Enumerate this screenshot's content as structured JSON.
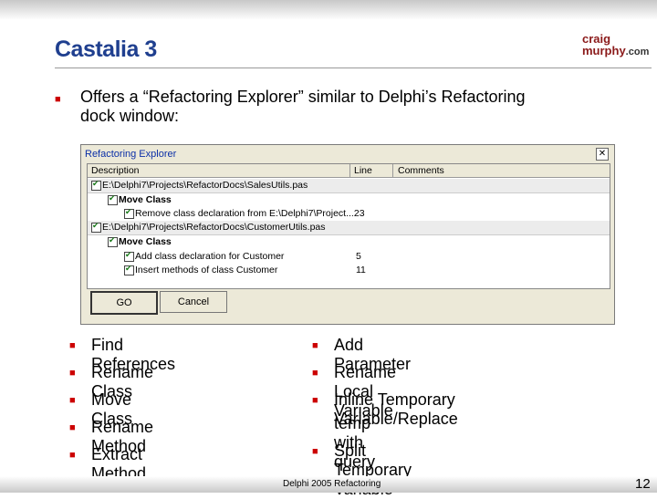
{
  "slide": {
    "title": "Castalia 3",
    "logo_line1": "craig",
    "logo_line2": "murphy",
    "logo_line2_suffix": ".com",
    "intro_line1": "Offers a “Refactoring Explorer” similar to Delphi’s Refactoring",
    "intro_line2": "dock window:",
    "footer": "Delphi 2005 Refactoring",
    "page_number": "12"
  },
  "window": {
    "title": "Refactoring Explorer",
    "close_glyph": "✕",
    "columns": [
      "Description",
      "Line",
      "Comments"
    ],
    "rows": [
      {
        "text": "E:\\Delphi7\\Projects\\RefactorDocs\\SalesUtils.pas",
        "line": ""
      },
      {
        "text": "Move Class",
        "line": ""
      },
      {
        "text": "Remove class declaration from E:\\Delphi7\\Project...23",
        "line": ""
      },
      {
        "text": "E:\\Delphi7\\Projects\\RefactorDocs\\CustomerUtils.pas",
        "line": ""
      },
      {
        "text": "Move Class",
        "line": ""
      },
      {
        "text": "Add class declaration for Customer",
        "line": "5"
      },
      {
        "text": "Insert methods of class Customer",
        "line": "11"
      }
    ],
    "go_label": "GO",
    "cancel_label": "Cancel"
  },
  "left_bullets": [
    "Find References",
    "Rename Class",
    "Move Class",
    "Rename Method",
    "Extract Method"
  ],
  "right_bullets": [
    "Add Parameter",
    "Rename Local Variable",
    "Inline Temporary Variable/Replace",
    "temp with query",
    "Split Temporary Variable"
  ],
  "bullet_glyph": "■"
}
